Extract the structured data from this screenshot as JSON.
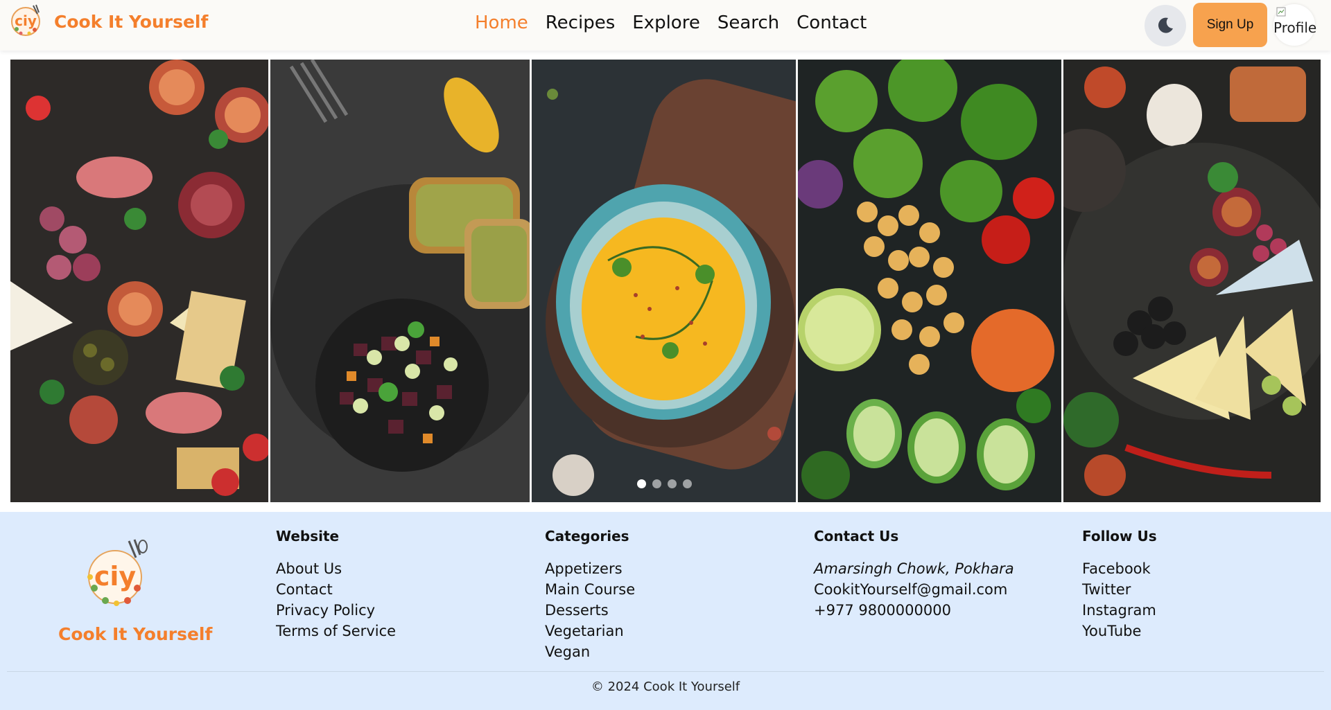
{
  "header": {
    "brand_name": "Cook It Yourself",
    "logo_text": "ciy",
    "nav": [
      {
        "label": "Home",
        "active": true
      },
      {
        "label": "Recipes",
        "active": false
      },
      {
        "label": "Explore",
        "active": false
      },
      {
        "label": "Search",
        "active": false
      },
      {
        "label": "Contact",
        "active": false
      }
    ],
    "theme_icon": "moon-icon",
    "signup_label": "Sign Up",
    "profile_alt": "Profile"
  },
  "carousel": {
    "panels": [
      "charcuterie",
      "tuna-tartare",
      "pumpkin-soup",
      "chickpea-salad",
      "cheese-platter"
    ],
    "slide_count": 4,
    "active_slide": 1
  },
  "footer": {
    "logo_text": "ciy",
    "brand_name": "Cook It Yourself",
    "website": {
      "title": "Website",
      "links": [
        "About Us",
        "Contact",
        "Privacy Policy",
        "Terms of Service"
      ]
    },
    "categories": {
      "title": "Categories",
      "links": [
        "Appetizers",
        "Main Course",
        "Desserts",
        "Vegetarian",
        "Vegan"
      ]
    },
    "contact": {
      "title": "Contact Us",
      "address": "Amarsingh Chowk, Pokhara",
      "email": "CookitYourself@gmail.com",
      "phone": "+977 9800000000"
    },
    "follow": {
      "title": "Follow Us",
      "links": [
        "Facebook",
        "Twitter",
        "Instagram",
        "YouTube"
      ]
    },
    "copyright": "© 2024 Cook It Yourself"
  },
  "colors": {
    "accent": "#f47f2c",
    "signup_bg": "#f7a24e",
    "footer_bg": "#ddebfd",
    "header_bg": "#fbfaf7"
  }
}
